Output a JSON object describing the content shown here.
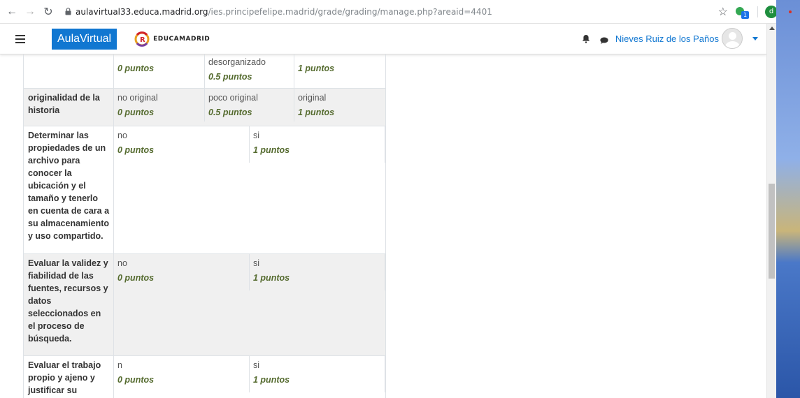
{
  "browser": {
    "url_domain": "aulavirtual33.educa.madrid.org",
    "url_path": "/ies.principefelipe.madrid/grade/grading/manage.php?areaid=4401",
    "profile_initial": "d",
    "extension_badge": "1"
  },
  "navbar": {
    "brand": "AulaVirtual",
    "logo_text": "EducaMadrid",
    "username": "Nieves Ruiz de los Paños"
  },
  "rubric": {
    "rows": [
      {
        "criterion": "",
        "levels": [
          {
            "desc": "",
            "points": "0 puntos"
          },
          {
            "desc": "desorganizado",
            "points": "0.5 puntos"
          },
          {
            "desc": "",
            "points": "1 puntos"
          }
        ]
      },
      {
        "criterion": "originalidad de la historia",
        "levels": [
          {
            "desc": "no original",
            "points": "0 puntos"
          },
          {
            "desc": "poco original",
            "points": "0.5 puntos"
          },
          {
            "desc": "original",
            "points": "1 puntos"
          }
        ]
      },
      {
        "criterion": "Determinar las propiedades de un archivo para conocer la ubicación y el tamaño y tenerlo en cuenta de cara a su almacenamiento y uso compartido.",
        "levels": [
          {
            "desc": "no",
            "points": "0 puntos"
          },
          {
            "desc": "si",
            "points": "1 puntos"
          }
        ]
      },
      {
        "criterion": "Evaluar la validez y fiabilidad de las fuentes, recursos y datos seleccionados en el proceso de búsqueda.",
        "levels": [
          {
            "desc": "no",
            "points": "0 puntos"
          },
          {
            "desc": "si",
            "points": "1 puntos"
          }
        ]
      },
      {
        "criterion": "Evaluar el trabajo propio y ajeno y justificar su",
        "levels": [
          {
            "desc": "n",
            "points": "0 puntos"
          },
          {
            "desc": "si",
            "points": "1 puntos"
          }
        ]
      }
    ]
  }
}
